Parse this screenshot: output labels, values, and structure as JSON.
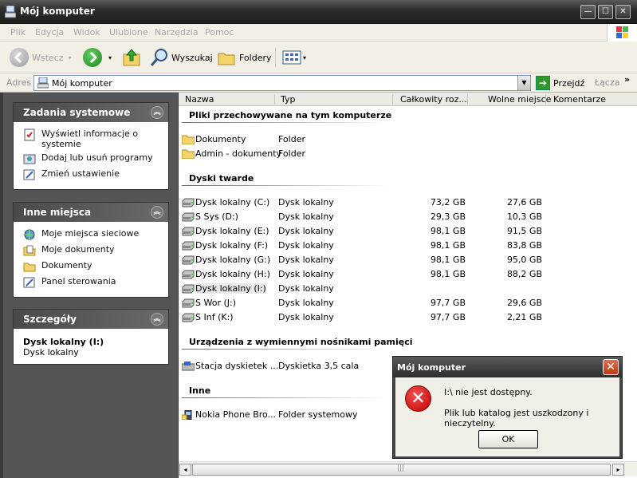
{
  "window": {
    "title": "Mój komputer",
    "min_glyph": "—",
    "max_glyph": "☐",
    "close_glyph": "✕"
  },
  "menu": [
    "Plik",
    "Edycja",
    "Widok",
    "Ulubione",
    "Narzędzia",
    "Pomoc"
  ],
  "toolbar": {
    "back_label": "Wstecz",
    "search_label": "Wyszukaj",
    "folders_label": "Foldery"
  },
  "address": {
    "label": "Adres",
    "value": "Mój komputer",
    "go_label": "Przejdź",
    "links_label": "Łącza",
    "more_glyph": "»"
  },
  "left": {
    "system_tasks": {
      "title": "Zadania systemowe",
      "items": [
        "Wyświetl informacje o systemie",
        "Dodaj lub usuń programy",
        "Zmień ustawienie"
      ]
    },
    "other_places": {
      "title": "Inne miejsca",
      "items": [
        "Moje miejsca sieciowe",
        "Moje dokumenty",
        "Dokumenty",
        "Panel sterowania"
      ]
    },
    "details": {
      "title": "Szczegóły",
      "name": "Dysk lokalny (I:)",
      "type": "Dysk lokalny"
    }
  },
  "columns": [
    "Nazwa",
    "Typ",
    "Całkowity roz...",
    "Wolne miejsce",
    "Komentarze"
  ],
  "groups": {
    "stored_files": "Pliki przechowywane na tym komputerze",
    "hard_drives": "Dyski twarde",
    "removable": "Urządzenia z wymiennymi nośnikami pamięci",
    "other": "Inne"
  },
  "stored_files": [
    {
      "name": "Dokumenty",
      "type": "Folder"
    },
    {
      "name": "Admin - dokumenty",
      "type": "Folder"
    }
  ],
  "drives": [
    {
      "name": "Dysk lokalny (C:)",
      "type": "Dysk lokalny",
      "total": "73,2 GB",
      "free": "27,6 GB"
    },
    {
      "name": "S Sys (D:)",
      "type": "Dysk lokalny",
      "total": "29,3 GB",
      "free": "10,3 GB"
    },
    {
      "name": "Dysk lokalny (E:)",
      "type": "Dysk lokalny",
      "total": "98,1 GB",
      "free": "91,5 GB"
    },
    {
      "name": "Dysk lokalny (F:)",
      "type": "Dysk lokalny",
      "total": "98,1 GB",
      "free": "83,8 GB"
    },
    {
      "name": "Dysk lokalny (G:)",
      "type": "Dysk lokalny",
      "total": "98,1 GB",
      "free": "95,0 GB"
    },
    {
      "name": "Dysk lokalny (H:)",
      "type": "Dysk lokalny",
      "total": "98,1 GB",
      "free": "88,2 GB"
    },
    {
      "name": "Dysk lokalny (I:)",
      "type": "Dysk lokalny",
      "total": "",
      "free": ""
    },
    {
      "name": "S Wor (J:)",
      "type": "Dysk lokalny",
      "total": "97,7 GB",
      "free": "29,6 GB"
    },
    {
      "name": "S Inf (K:)",
      "type": "Dysk lokalny",
      "total": "97,7 GB",
      "free": "2,21 GB"
    }
  ],
  "removable": [
    {
      "name": "Stacja dyskietek ...",
      "type": "Dyskietka 3,5 cala"
    }
  ],
  "other_items": [
    {
      "name": "Nokia Phone Bro...",
      "type": "Folder systemowy"
    }
  ],
  "dialog": {
    "title": "Mój komputer",
    "close_glyph": "✕",
    "icon_glyph": "✕",
    "message1": "I:\\ nie jest dostępny.",
    "message2": "Plik lub katalog jest uszkodzony i nieczytelny.",
    "ok_label": "OK"
  },
  "scroll": {
    "left_glyph": "◂",
    "right_glyph": "▸",
    "grip": "|||"
  },
  "colors": {
    "accent": "#2e2e2e",
    "go_green": "#2b9a2b",
    "error_red": "#c00000"
  }
}
